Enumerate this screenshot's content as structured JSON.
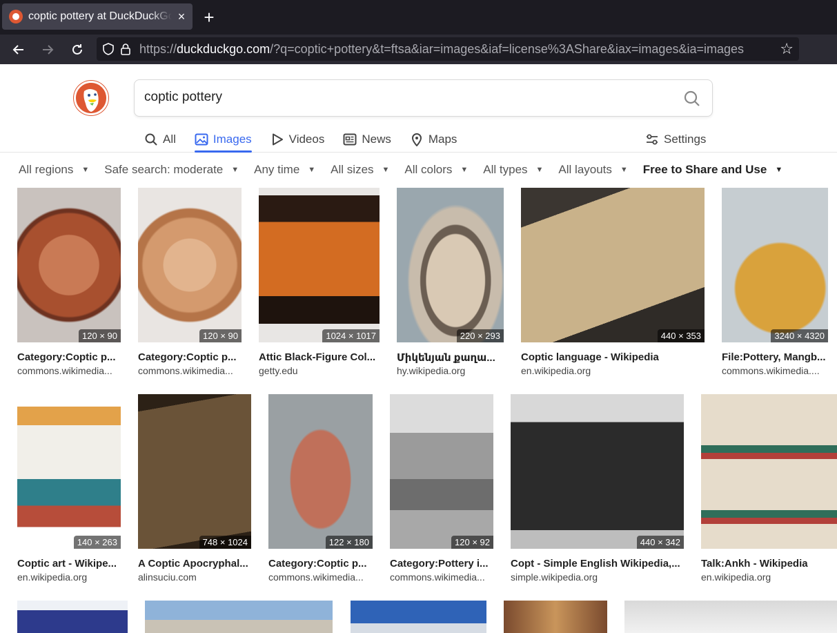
{
  "browser": {
    "tab_title": "coptic pottery at DuckDuckGo",
    "tab_close": "×",
    "new_tab": "+",
    "url_prefix": "https://",
    "url_host": "duckduckgo.com",
    "url_path": "/?q=coptic+pottery&t=ftsa&iar=images&iaf=license%3AShare&iax=images&ia=images"
  },
  "search": {
    "query": "coptic pottery"
  },
  "nav_tabs": [
    {
      "label": "All",
      "icon": "search-icon"
    },
    {
      "label": "Images",
      "icon": "image-icon"
    },
    {
      "label": "Videos",
      "icon": "play-icon"
    },
    {
      "label": "News",
      "icon": "news-icon"
    },
    {
      "label": "Maps",
      "icon": "map-pin-icon"
    }
  ],
  "settings_label": "Settings",
  "filters": [
    {
      "label": "All regions"
    },
    {
      "label": "Safe search: moderate"
    },
    {
      "label": "Any time"
    },
    {
      "label": "All sizes"
    },
    {
      "label": "All colors"
    },
    {
      "label": "All types"
    },
    {
      "label": "All layouts"
    },
    {
      "label": "Free to Share and Use"
    }
  ],
  "results": [
    {
      "title": "Category:Coptic p...",
      "source": "commons.wikimedia...",
      "dims": "120 × 90"
    },
    {
      "title": "Category:Coptic p...",
      "source": "commons.wikimedia...",
      "dims": "120 × 90"
    },
    {
      "title": "Attic Black-Figure Col...",
      "source": "getty.edu",
      "dims": "1024 × 1017"
    },
    {
      "title": "Միկենյան քաղա...",
      "source": "hy.wikipedia.org",
      "dims": "220 × 293"
    },
    {
      "title": "Coptic language - Wikipedia",
      "source": "en.wikipedia.org",
      "dims": "440 × 353"
    },
    {
      "title": "File:Pottery, Mangb...",
      "source": "commons.wikimedia....",
      "dims": "3240 × 4320"
    },
    {
      "title": "Coptic art - Wikipe...",
      "source": "en.wikipedia.org",
      "dims": "140 × 263"
    },
    {
      "title": "A Coptic Apocryphal...",
      "source": "alinsuciu.com",
      "dims": "748 × 1024"
    },
    {
      "title": "Category:Coptic p...",
      "source": "commons.wikimedia...",
      "dims": "122 × 180"
    },
    {
      "title": "Category:Pottery i...",
      "source": "commons.wikimedia...",
      "dims": "120 × 92"
    },
    {
      "title": "Copt - Simple English Wikipedia,...",
      "source": "simple.wikipedia.org",
      "dims": "440 × 342"
    },
    {
      "title": "Talk:Ankh - Wikipedia",
      "source": "en.wikipedia.org",
      "dims": ""
    }
  ],
  "colors": {
    "accent": "#3969ef",
    "brand": "#de5833"
  }
}
